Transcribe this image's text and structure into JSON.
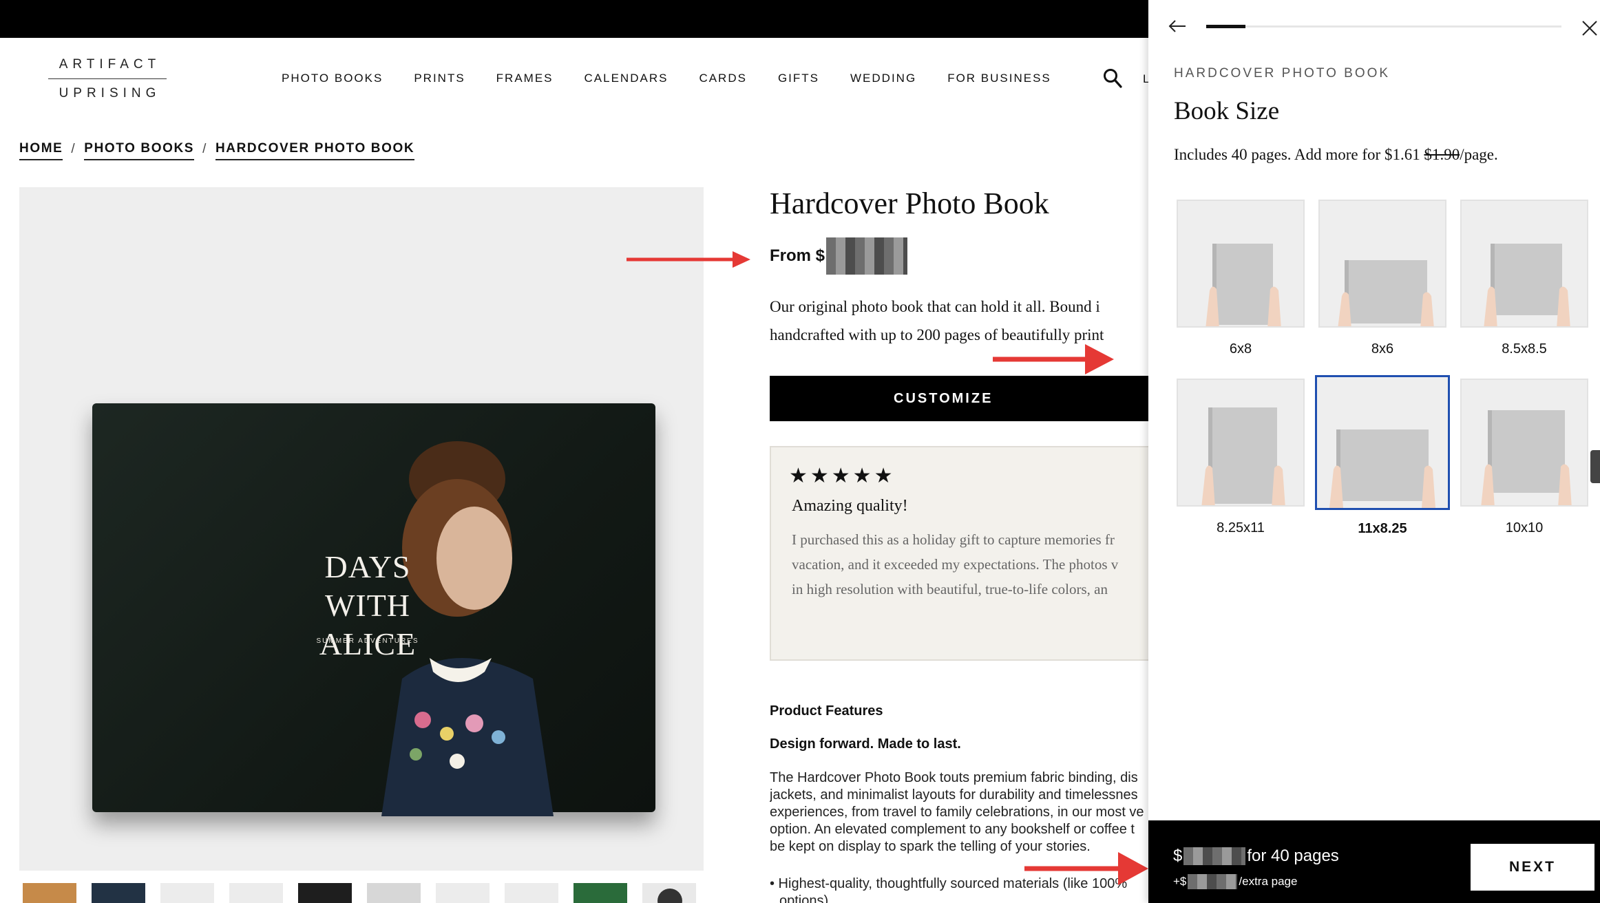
{
  "header": {
    "logo_top": "ARTIFACT",
    "logo_bottom": "UPRISING",
    "nav": [
      "PHOTO BOOKS",
      "PRINTS",
      "FRAMES",
      "CALENDARS",
      "CARDS",
      "GIFTS",
      "WEDDING",
      "FOR BUSINESS"
    ],
    "account_stub": "L"
  },
  "breadcrumb": [
    "HOME",
    "PHOTO BOOKS",
    "HARDCOVER PHOTO BOOK"
  ],
  "hero": {
    "book_title": "DAYS WITH ALICE",
    "book_subtitle": "SUMMER ADVENTURES"
  },
  "product": {
    "title": "Hardcover Photo Book",
    "price_prefix": "From $",
    "description_line1": "Our original photo book that can hold it all. Bound i",
    "description_line2": "handcrafted with up to 200 pages of beautifully print",
    "customize_label": "CUSTOMIZE"
  },
  "review": {
    "stars": "★★★★★",
    "title": "Amazing quality!",
    "line1": "I purchased this as a holiday gift to capture memories fr",
    "line2": "vacation, and it exceeded my expectations. The photos v",
    "line3": "in high resolution with beautiful, true-to-life colors, an"
  },
  "features": {
    "heading": "Product Features",
    "subheading": "Design forward. Made to last.",
    "body_line1": "The Hardcover Photo Book touts premium fabric binding, dis",
    "body_line2": "jackets, and minimalist layouts for durability and timelessnes",
    "body_line3": "experiences, from travel to family celebrations, in our most ve",
    "body_line4": "option. An elevated complement to any bookshelf or coffee t",
    "body_line5": "be kept on display to spark the telling of your stories.",
    "bullet_line1": "• Highest-quality, thoughtfully sourced materials (like 100%",
    "bullet_line2": "options)"
  },
  "panel": {
    "progress_fraction": 0.11,
    "eyebrow": "HARDCOVER PHOTO BOOK",
    "title": "Book Size",
    "includes_prefix": "Includes 40 pages. Add more for $1.61 ",
    "includes_strike": "$1.90",
    "includes_suffix": "/page.",
    "sizes": [
      {
        "label": "6x8",
        "selected": false
      },
      {
        "label": "8x6",
        "selected": false
      },
      {
        "label": "8.5x8.5",
        "selected": false
      },
      {
        "label": "8.25x11",
        "selected": false
      },
      {
        "label": "11x8.25",
        "selected": true
      },
      {
        "label": "10x10",
        "selected": false
      }
    ],
    "footer_price_prefix": "$",
    "footer_price_suffix": "for 40 pages",
    "footer_extra_prefix": "+$",
    "footer_extra_suffix": "/extra page",
    "next_label": "NEXT"
  },
  "colors": {
    "accent_selected": "#1f4fb0",
    "annotation_arrow": "#e53935",
    "review_bg": "#f3f1ec"
  }
}
